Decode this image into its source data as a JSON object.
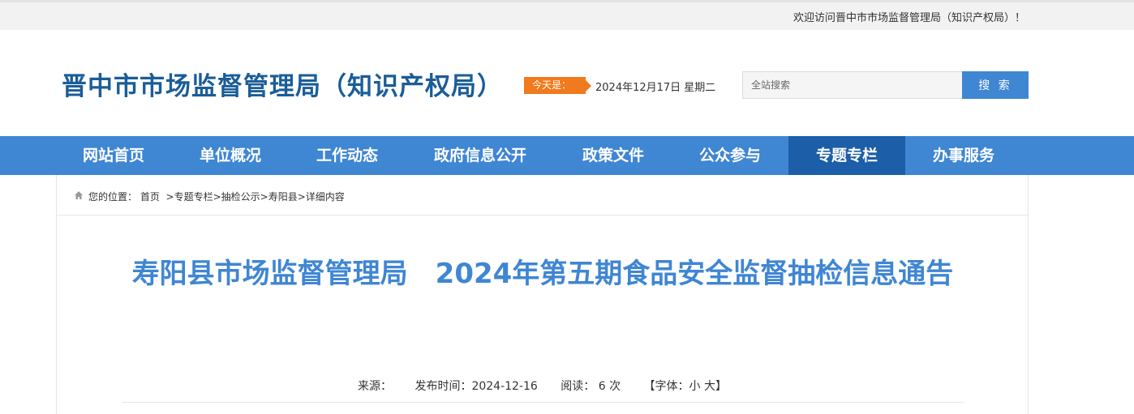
{
  "topbar": {
    "welcome": "欢迎访问晋中市市场监督管理局（知识产权局）！"
  },
  "header": {
    "site_title": "晋中市市场监督管理局（知识产权局）",
    "today_label": "今天是：",
    "today_date": "2024年12月17日 星期二",
    "search_placeholder": "全站搜索",
    "search_button": "搜 索"
  },
  "nav": {
    "items": [
      {
        "label": "网站首页"
      },
      {
        "label": "单位概况"
      },
      {
        "label": "工作动态"
      },
      {
        "label": "政府信息公开"
      },
      {
        "label": "政策文件"
      },
      {
        "label": "公众参与"
      },
      {
        "label": "专题专栏",
        "active": true
      },
      {
        "label": "办事服务"
      }
    ]
  },
  "breadcrumb": {
    "prefix": "您的位置：",
    "items": [
      "首页",
      "专题专栏",
      "抽检公示",
      "寿阳县",
      "详细内容"
    ]
  },
  "article": {
    "title": "寿阳县市场监督管理局　2024年第五期食品安全监督抽检信息通告",
    "source": "来源：",
    "publish_time": "发布时间：2024-12-16",
    "reads": "阅读： 6 次",
    "font_size": "【字体：小 大】"
  },
  "colors": {
    "primary": "#3f86d3",
    "nav_active": "#1c5ea7",
    "title": "#1a5d98",
    "accent": "#f07a1d"
  }
}
